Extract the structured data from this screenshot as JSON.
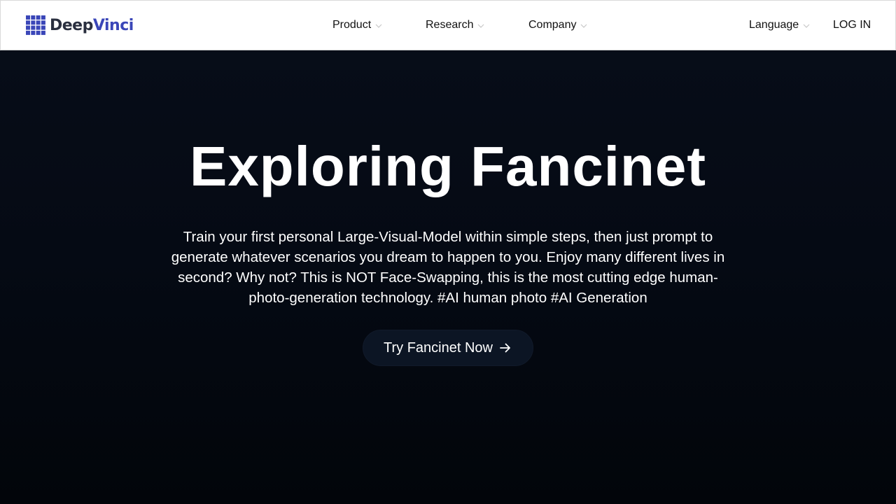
{
  "brand": {
    "name_part1": "Deep",
    "name_part2": "Vinci",
    "accent_color": "#3a46b8"
  },
  "nav": {
    "items": [
      {
        "label": "Product",
        "icon": "chevron-down-icon"
      },
      {
        "label": "Research",
        "icon": "chevron-down-icon"
      },
      {
        "label": "Company",
        "icon": "chevron-down-icon"
      }
    ],
    "language_label": "Language",
    "login_label": "LOG IN"
  },
  "hero": {
    "title": "Exploring Fancinet",
    "description": "Train your first personal Large-Visual-Model within simple steps, then just prompt to generate whatever scenarios you dream to happen to you. Enjoy many different lives in second? Why not? This is NOT Face-Swapping, this is the most cutting edge human-photo-generation technology. #AI human photo #AI Generation",
    "cta_label": "Try Fancinet Now",
    "cta_icon": "arrow-right-icon",
    "background_color": "#050a14"
  }
}
